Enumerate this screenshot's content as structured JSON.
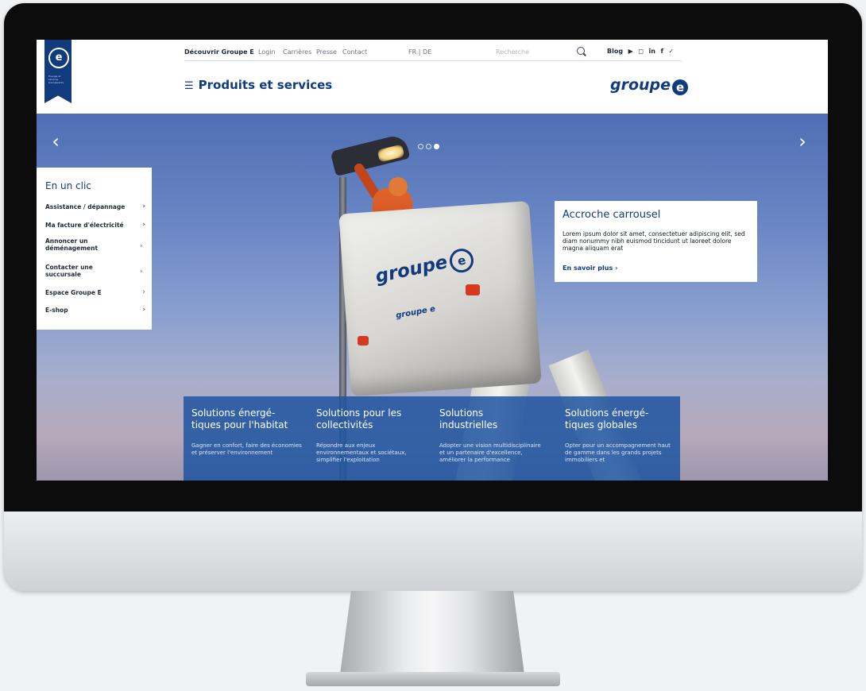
{
  "header": {
    "logo_letter": "e",
    "logo_tagline": "Energie et services transparents",
    "topnav": {
      "discover": "Découvrir Groupe E",
      "login": "Login",
      "careers": "Carrières",
      "press": "Presse",
      "contact": "Contact",
      "languages": "FR | DE",
      "search_placeholder": "Recherche",
      "blog": "Blog"
    },
    "social_icons": [
      "youtube-icon",
      "instagram-icon",
      "linkedin-icon",
      "facebook-icon",
      "twitter-icon"
    ],
    "menu_label": "Produits et services",
    "brand": "groupe",
    "brand_mark": "e"
  },
  "hero": {
    "truck_brand": "groupe",
    "truck_brand_mark": "e",
    "truck_small_brand": "groupe e",
    "prev_arrow": "‹",
    "next_arrow": "›",
    "slides_count": 3,
    "active_slide": 3
  },
  "quick_links": {
    "title": "En un clic",
    "items": [
      "Assistance / dépannage",
      "Ma facture d'électricité",
      "Annoncer un déménagement",
      "Contacter une succursale",
      "Espace Groupe E",
      "E-shop"
    ]
  },
  "carousel_card": {
    "title": "Accroche carrousel",
    "text": "Lorem ipsum dolor sit amet, consectetuer adipiscing elit, sed diam nonummy nibh euismod tincidunt ut laoreet dolore magna aliquam erat",
    "link": "En savoir plus ›"
  },
  "solutions": [
    {
      "title": "Solutions énergé-tiques pour l'habitat",
      "text": "Gagner en confort, faire des économies et préserver l'environnement"
    },
    {
      "title": "Solutions pour les collectivités",
      "text": "Répondre aux enjeux environnementaux et sociétaux, simplifier l'exploitation"
    },
    {
      "title": "Solutions industrielles",
      "text": "Adopter une vision multidisciplinaire et un partenaire d'excellence, améliorer la performance"
    },
    {
      "title": "Solutions énergé-tiques globales",
      "text": "Opter pour un accompagnement haut de gamme dans les grands projets immobiliers et"
    }
  ],
  "colors": {
    "brand_blue": "#123b7d",
    "band_blue": "#1f55a1"
  }
}
